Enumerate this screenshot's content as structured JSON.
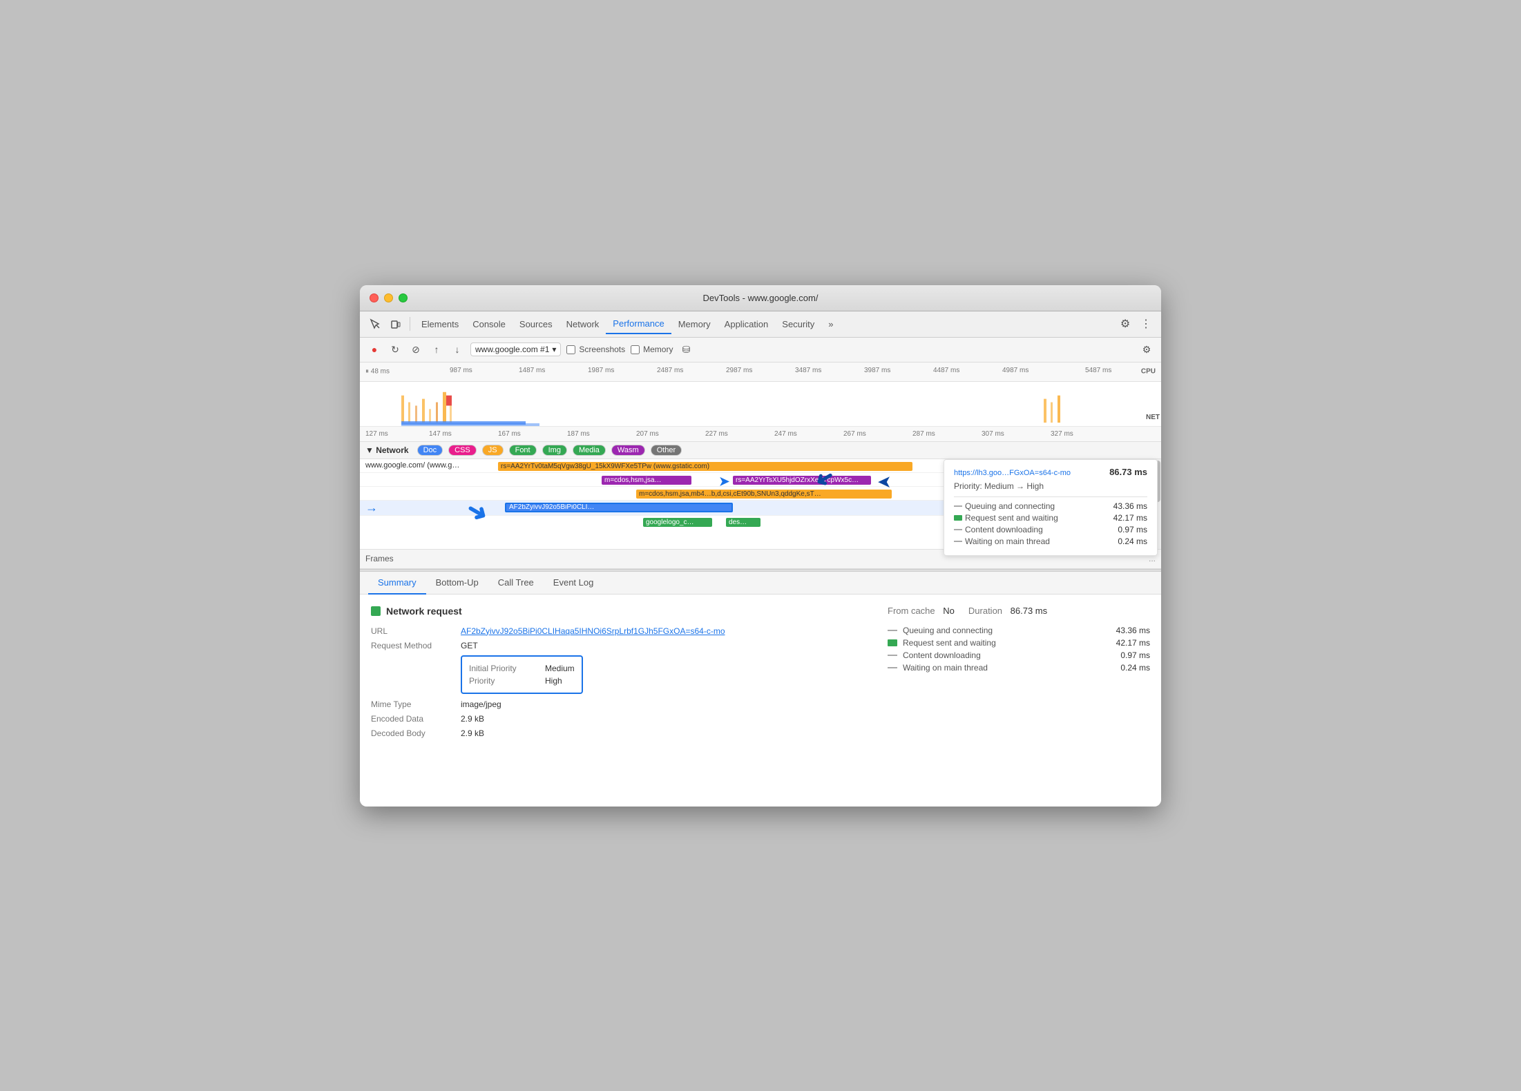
{
  "window": {
    "title": "DevTools - www.google.com/"
  },
  "tabs": {
    "items": [
      {
        "label": "Elements",
        "active": false
      },
      {
        "label": "Console",
        "active": false
      },
      {
        "label": "Sources",
        "active": false
      },
      {
        "label": "Network",
        "active": false
      },
      {
        "label": "Performance",
        "active": true
      },
      {
        "label": "Memory",
        "active": false
      },
      {
        "label": "Application",
        "active": false
      },
      {
        "label": "Security",
        "active": false
      },
      {
        "label": "»",
        "active": false
      }
    ]
  },
  "perf_toolbar": {
    "url": "www.google.com #1",
    "screenshots_label": "Screenshots",
    "memory_label": "Memory"
  },
  "timeline": {
    "ruler_labels": [
      "48 ms",
      "987 ms",
      "1487 ms",
      "1987 ms",
      "2487 ms",
      "2987 ms",
      "3487 ms",
      "3987 ms",
      "4487 ms",
      "4987 ms",
      "5487 ms"
    ],
    "network_ruler": [
      "127 ms",
      "147 ms",
      "167 ms",
      "187 ms",
      "207 ms",
      "227 ms",
      "247 ms",
      "267 ms",
      "287 ms",
      "307 ms",
      "327 ms"
    ],
    "cpu_label": "CPU",
    "net_label": "NET"
  },
  "network_filters": {
    "label": "Network",
    "filters": [
      "Doc",
      "CSS",
      "JS",
      "Font",
      "Img",
      "Media",
      "Wasm",
      "Other"
    ]
  },
  "network_rows": [
    {
      "label": "www.google.com/ (www.g…",
      "bar_text": "rs=AA2YrTv0taM5qVgw38gU_15kX9WFXe5TPw (www.gstatic.com)",
      "bar_color": "yellow"
    },
    {
      "label": "",
      "bar_text": "m=cdos,hsm,jsa…",
      "bar_text2": "rs=AA2YrTsXU5hjdOZrxXehYcpWx5c…",
      "bar_color": "blue"
    },
    {
      "label": "",
      "bar_text": "m=cdos,hsm,jsa,mb4…b,d,csi,cEt90b,SNUn3,qddgKe,sT…",
      "bar_color": "yellow"
    },
    {
      "label": "",
      "bar_text": "AF2bZyivvJ92o5BiPi0CLIHaqa5IHNOi6SrpLrbf1GJh5FGxOA=s64-c-mo",
      "bar_color": "blue",
      "selected": true
    },
    {
      "label": "",
      "bar_text": "googlelogo_c…",
      "bar_text2": "des…",
      "bar_color": "green"
    }
  ],
  "tooltip": {
    "url": "https://lh3.goo…FGxOA=s64-c-mo",
    "time": "86.73 ms",
    "priority_from": "Medium",
    "priority_to": "High",
    "rows": [
      {
        "icon": "line",
        "label": "Queuing and connecting",
        "value": "43.36 ms"
      },
      {
        "icon": "box-green",
        "label": "Request sent and waiting",
        "value": "42.17 ms"
      },
      {
        "icon": "line",
        "label": "Content downloading",
        "value": "0.97 ms"
      },
      {
        "icon": "line",
        "label": "Waiting on main thread",
        "value": "0.24 ms"
      }
    ]
  },
  "frames": {
    "label": "Frames",
    "dots": "..."
  },
  "bottom_tabs": [
    {
      "label": "Summary",
      "active": true
    },
    {
      "label": "Bottom-Up",
      "active": false
    },
    {
      "label": "Call Tree",
      "active": false
    },
    {
      "label": "Event Log",
      "active": false
    }
  ],
  "summary": {
    "section_title": "Network request",
    "url_label": "URL",
    "url_value": "AF2bZyivvJ92o5BiPi0CLIHaqa5IHNOi6SrpLrbf1GJh5FGxOA=s64-c-mo",
    "request_method_label": "Request Method",
    "request_method_value": "GET",
    "initial_priority_label": "Initial Priority",
    "initial_priority_value": "Medium",
    "priority_label": "Priority",
    "priority_value": "High",
    "mime_type_label": "Mime Type",
    "mime_type_value": "image/jpeg",
    "encoded_data_label": "Encoded Data",
    "encoded_data_value": "2.9 kB",
    "decoded_body_label": "Decoded Body",
    "decoded_body_value": "2.9 kB",
    "from_cache_label": "From cache",
    "from_cache_value": "No",
    "duration_label": "Duration",
    "duration_value": "86.73 ms",
    "timing_rows": [
      {
        "icon": "line",
        "label": "Queuing and connecting",
        "value": "43.36 ms"
      },
      {
        "icon": "box-green",
        "label": "Request sent and waiting",
        "value": "42.17 ms"
      },
      {
        "icon": "line",
        "label": "Content downloading",
        "value": "0.97 ms"
      },
      {
        "icon": "line",
        "label": "Waiting on main thread",
        "value": "0.24 ms"
      }
    ]
  }
}
